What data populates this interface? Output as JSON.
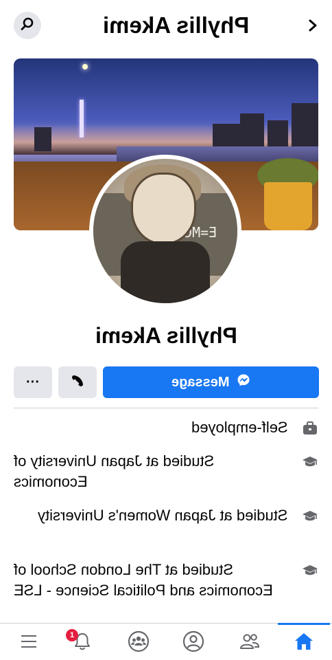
{
  "header": {
    "title": "Phyllis Akemi",
    "back_icon": "chevron-left-icon",
    "search_icon": "search-icon"
  },
  "profile": {
    "name": "Phyllis Akemi",
    "cover_description_icon": "cover-photo",
    "avatar_equation": "E=MC²"
  },
  "actions": {
    "message_label": "Message",
    "more_label": "···",
    "call_icon": "phone-icon",
    "messenger_icon": "messenger-icon"
  },
  "info": [
    {
      "icon": "briefcase-icon",
      "text": "Self-employed"
    },
    {
      "icon": "graduation-cap-icon",
      "text": "Studied at Japan University of Economics"
    },
    {
      "icon": "graduation-cap-icon",
      "text": "Studied at Japan Women's University"
    },
    {
      "icon": "graduation-cap-icon",
      "text": "Studied at The London School of Economics and Political Science - LSE"
    }
  ],
  "bottom_nav": {
    "items": [
      "menu-icon",
      "bell-icon",
      "groups-icon",
      "profile-icon",
      "friends-icon",
      "home-icon"
    ],
    "notification_count": "1",
    "active": "home-icon"
  },
  "colors": {
    "accent": "#1877f2",
    "button_gray": "#e4e6eb",
    "badge_red": "#e41e3f",
    "text": "#050505"
  }
}
